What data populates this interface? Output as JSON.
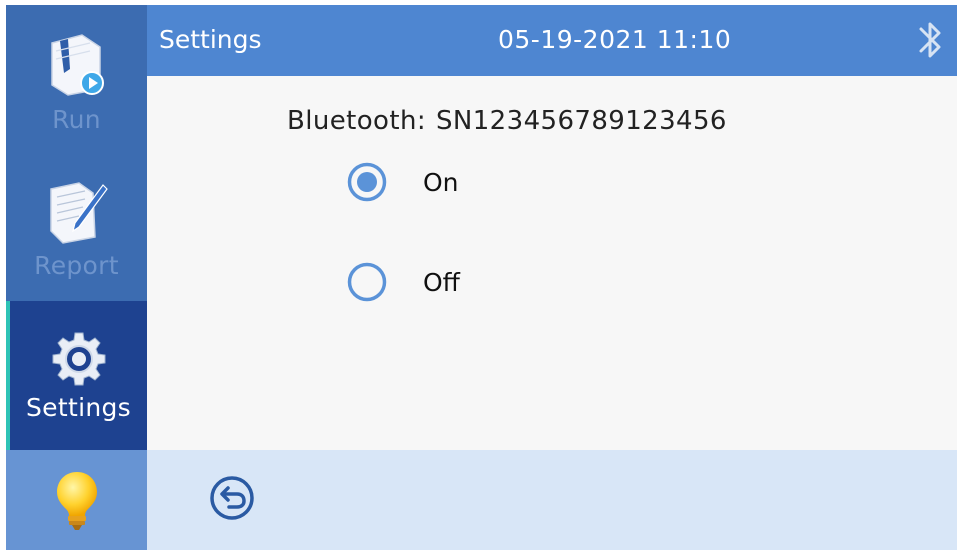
{
  "header": {
    "title": "Settings",
    "datetime": "05-19-2021 11:10",
    "status_icon": "bluetooth-icon"
  },
  "sidebar": {
    "items": [
      {
        "label": "Run",
        "icon": "run-book-icon",
        "active": false
      },
      {
        "label": "Report",
        "icon": "report-pen-icon",
        "active": false
      },
      {
        "label": "Settings",
        "icon": "gear-icon",
        "active": true
      },
      {
        "label": "",
        "icon": "lightbulb-icon",
        "active": false
      }
    ]
  },
  "settings": {
    "bluetooth_label": "Bluetooth:",
    "bluetooth_id": "SN123456789123456",
    "options": [
      {
        "label": "On",
        "selected": true
      },
      {
        "label": "Off",
        "selected": false
      }
    ]
  },
  "footer": {
    "back_icon": "back-arrow-icon"
  },
  "colors": {
    "sidebar_bg": "#3c6cb1",
    "sidebar_active_bg": "#1e4290",
    "sidebar_active_accent": "#2ec3b6",
    "header_bg": "#4e86d1",
    "radio_accent": "#5b93d8",
    "footer_bg": "#d8e6f7"
  }
}
